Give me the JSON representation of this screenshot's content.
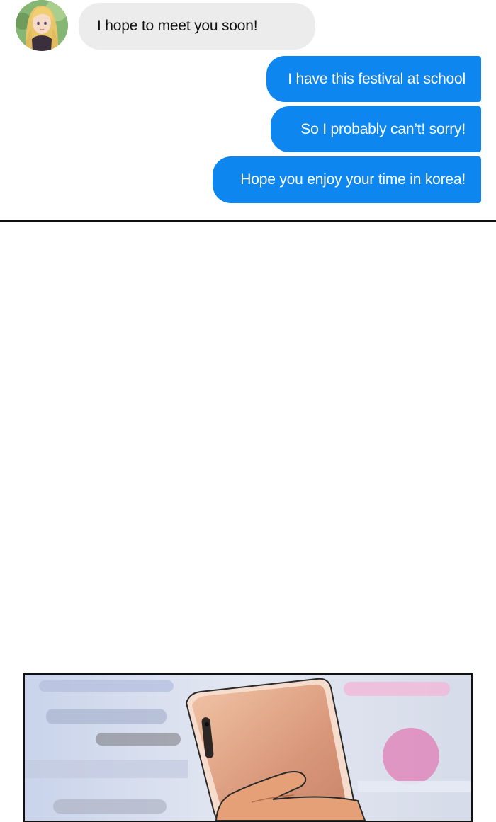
{
  "conversation": {
    "incoming": [
      {
        "text": "I hope to meet you soon!"
      }
    ],
    "outgoing": [
      {
        "text": "I have this festival at school"
      },
      {
        "text": "So I probably can’t! sorry!"
      },
      {
        "text": "Hope you enjoy your time in korea!"
      }
    ]
  },
  "colors": {
    "outgoing_bubble": "#0e86f0",
    "incoming_bubble": "#ececec"
  },
  "icons": {
    "avatar": "contact-avatar",
    "phone": "smartphone-in-hand"
  }
}
